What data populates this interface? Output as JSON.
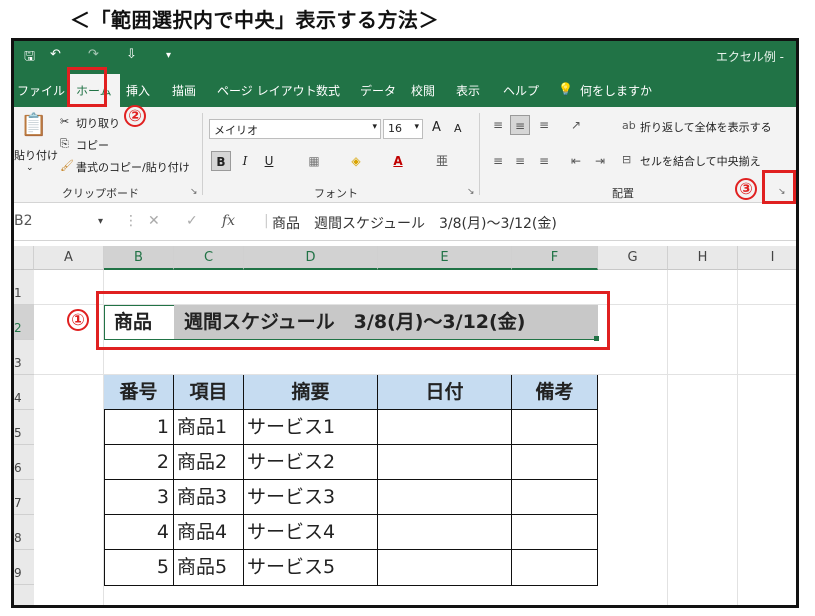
{
  "heading": "＜「範囲選択内で中央」表示する方法＞",
  "window": {
    "title": "エクセル例 -",
    "qat": {
      "save": "🖫",
      "undo": "↶",
      "redo": "↷",
      "customize": "⇩",
      "more": "▾"
    }
  },
  "tabs": [
    "ファイル",
    "ホーム",
    "挿入",
    "描画",
    "ページ レイアウト",
    "数式",
    "データ",
    "校閲",
    "表示",
    "ヘルプ",
    "何をしますか"
  ],
  "ribbon": {
    "clipboard": {
      "paste": "貼り付け",
      "cut": "切り取り",
      "copy": "コピー",
      "format_painter": "書式のコピー/貼り付け",
      "label": "クリップボード"
    },
    "font": {
      "name": "メイリオ",
      "size": "16",
      "grow": "A",
      "shrink": "A",
      "bold": "B",
      "italic": "I",
      "underline": "U",
      "font_color": "A",
      "label": "フォント"
    },
    "alignment": {
      "wrap": "折り返して全体を表示する",
      "merge": "セルを結合して中央揃え",
      "label": "配置"
    }
  },
  "formula_bar": {
    "name_box": "B2",
    "fx": "fx",
    "content": "商品　週間スケジュール　3/8(月)〜3/12(金)"
  },
  "columns": [
    "A",
    "B",
    "C",
    "D",
    "E",
    "F",
    "G",
    "H",
    "I"
  ],
  "rows": [
    "1",
    "2",
    "3",
    "4",
    "5",
    "6",
    "7",
    "8",
    "9"
  ],
  "sheet": {
    "title_label": "商品",
    "title_text": "週間スケジュール　3/8(月)〜3/12(金)",
    "table": {
      "headers": [
        "番号",
        "項目",
        "摘要",
        "日付",
        "備考"
      ],
      "rows": [
        [
          "1",
          "商品1",
          "サービス1",
          "",
          ""
        ],
        [
          "2",
          "商品2",
          "サービス2",
          "",
          ""
        ],
        [
          "3",
          "商品3",
          "サービス3",
          "",
          ""
        ],
        [
          "4",
          "商品4",
          "サービス4",
          "",
          ""
        ],
        [
          "5",
          "商品5",
          "サービス5",
          "",
          ""
        ]
      ]
    }
  },
  "annotations": {
    "m1": "①",
    "m2": "②",
    "m3": "③"
  },
  "colors": {
    "excel_green": "#217346",
    "header_fill": "#c6dcf1",
    "title_fill": "#c8c8c8",
    "marker_red": "#e02020"
  }
}
